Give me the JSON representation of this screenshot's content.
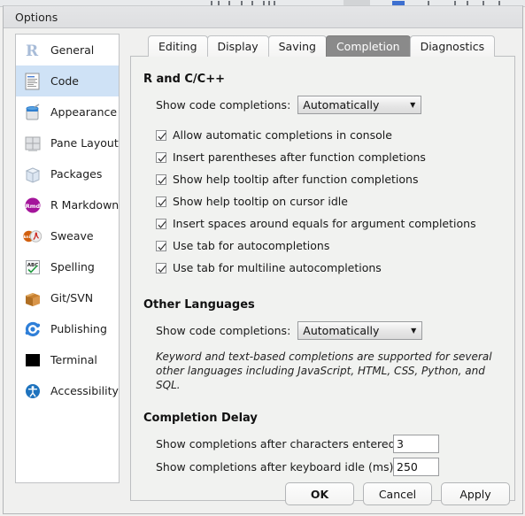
{
  "window": {
    "title": "Options"
  },
  "sidebar": {
    "items": [
      {
        "label": "General",
        "icon": "r-logo-icon",
        "selected": false
      },
      {
        "label": "Code",
        "icon": "document-icon",
        "selected": true
      },
      {
        "label": "Appearance",
        "icon": "paint-can-icon",
        "selected": false
      },
      {
        "label": "Pane Layout",
        "icon": "panes-grid-icon",
        "selected": false
      },
      {
        "label": "Packages",
        "icon": "box-icon",
        "selected": false
      },
      {
        "label": "R Markdown",
        "icon": "rmd-badge-icon",
        "selected": false
      },
      {
        "label": "Sweave",
        "icon": "knitr-pdf-icon",
        "selected": false
      },
      {
        "label": "Spelling",
        "icon": "abc-check-icon",
        "selected": false
      },
      {
        "label": "Git/SVN",
        "icon": "carton-box-icon",
        "selected": false
      },
      {
        "label": "Publishing",
        "icon": "publish-icon",
        "selected": false
      },
      {
        "label": "Terminal",
        "icon": "terminal-icon",
        "selected": false
      },
      {
        "label": "Accessibility",
        "icon": "accessibility-icon",
        "selected": false
      }
    ]
  },
  "tabs": [
    {
      "label": "Editing",
      "active": false
    },
    {
      "label": "Display",
      "active": false
    },
    {
      "label": "Saving",
      "active": false
    },
    {
      "label": "Completion",
      "active": true
    },
    {
      "label": "Diagnostics",
      "active": false
    }
  ],
  "main": {
    "r_cpp": {
      "heading": "R and C/C++",
      "show_completions_label": "Show code completions:",
      "show_completions_value": "Automatically",
      "checkboxes": [
        {
          "label": "Allow automatic completions in console",
          "checked": true
        },
        {
          "label": "Insert parentheses after function completions",
          "checked": true
        },
        {
          "label": "Show help tooltip after function completions",
          "checked": true
        },
        {
          "label": "Show help tooltip on cursor idle",
          "checked": true
        },
        {
          "label": "Insert spaces around equals for argument completions",
          "checked": true
        },
        {
          "label": "Use tab for autocompletions",
          "checked": true
        },
        {
          "label": "Use tab for multiline autocompletions",
          "checked": true
        }
      ]
    },
    "other_languages": {
      "heading": "Other Languages",
      "show_completions_label": "Show code completions:",
      "show_completions_value": "Automatically",
      "note": "Keyword and text-based completions are supported for several other languages including JavaScript, HTML, CSS, Python, and SQL."
    },
    "completion_delay": {
      "heading": "Completion Delay",
      "chars_label": "Show completions after characters entered:",
      "chars_value": "3",
      "idle_label": "Show completions after keyboard idle (ms):",
      "idle_value": "250"
    }
  },
  "footer": {
    "ok": "OK",
    "cancel": "Cancel",
    "apply": "Apply"
  },
  "colors": {
    "selection": "#cfe2f6",
    "active_tab": "#8a8a8a",
    "panel_bg": "#f1f2f0",
    "dialog_bg": "#f0f0ef"
  }
}
